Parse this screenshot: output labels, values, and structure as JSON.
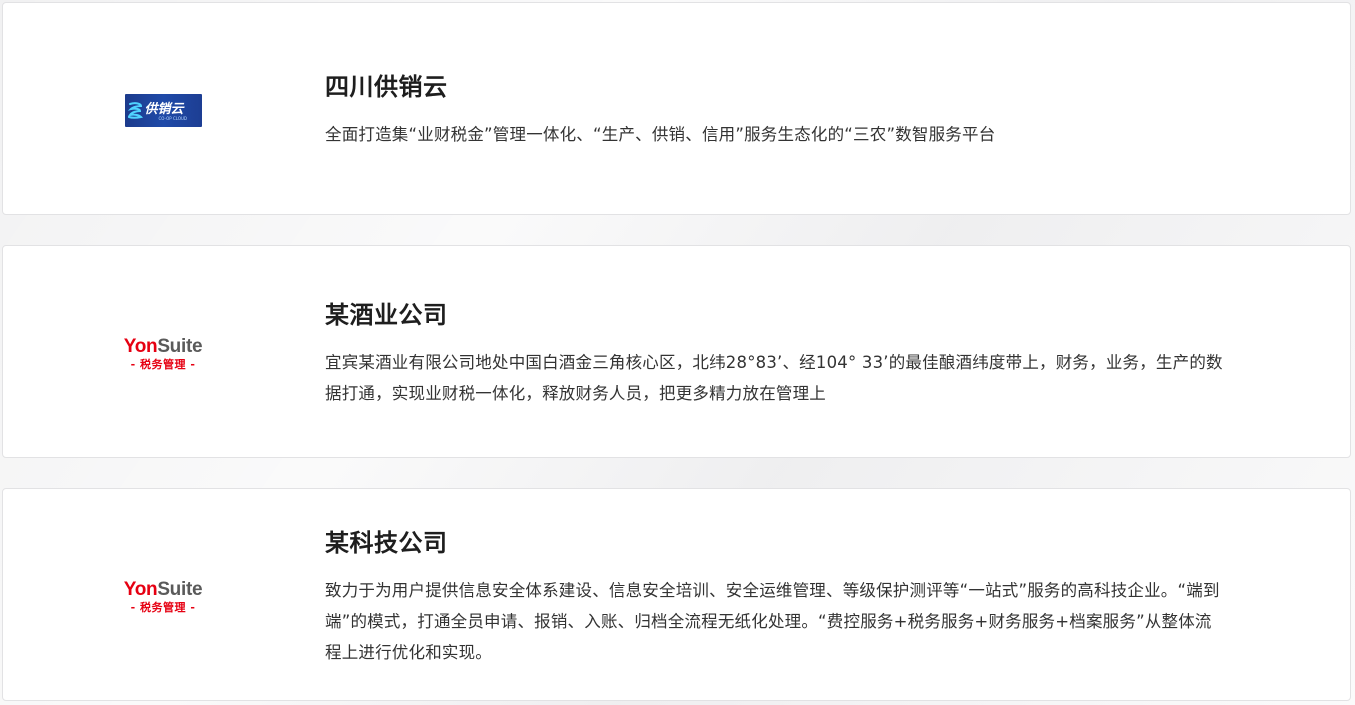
{
  "cards": [
    {
      "logo": {
        "type": "gongxiaoyun",
        "icon": "coop-cloud-logo-icon",
        "text": "供销云",
        "subtext": "CO-OP CLOUD",
        "bg_color": "#1f4aa8"
      },
      "title": "四川供销云",
      "description": "全面打造集“业财税金”管理一体化、“生产、供销、信用”服务生态化的“三农”数智服务平台"
    },
    {
      "logo": {
        "type": "yonsuite",
        "brand_a": "Yon",
        "brand_b": "Suite",
        "subtext": "- 税务管理 -",
        "accent_color": "#e60012"
      },
      "title": "某酒业公司",
      "description": "宜宾某酒业有限公司地处中国白酒金三角核心区，北纬28°83’、经104° 33’的最佳酿酒纬度带上，财务，业务，生产的数据打通，实现业财税一体化，释放财务人员，把更多精力放在管理上"
    },
    {
      "logo": {
        "type": "yonsuite",
        "brand_a": "Yon",
        "brand_b": "Suite",
        "subtext": "- 税务管理 -",
        "accent_color": "#e60012"
      },
      "title": "某科技公司",
      "description": "致力于为用户提供信息安全体系建设、信息安全培训、安全运维管理、等级保护测评等“一站式”服务的高科技企业。“端到端”的模式，打通全员申请、报销、入账、归档全流程无纸化处理。“费控服务+税务服务+财务服务+档案服务”从整体流程上进行优化和实现。"
    }
  ]
}
